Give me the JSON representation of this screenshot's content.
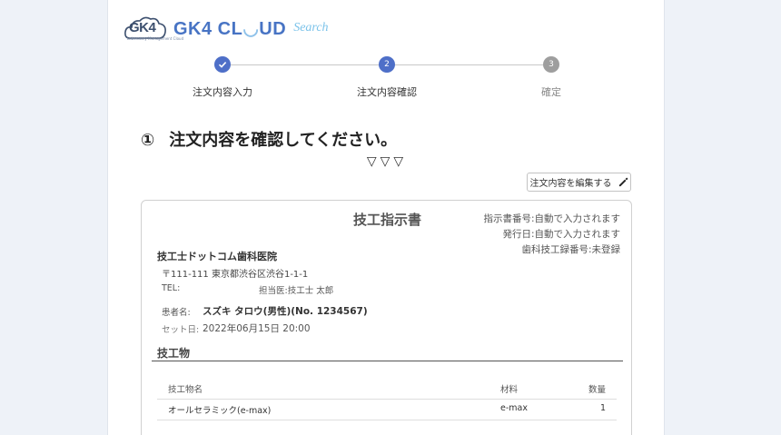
{
  "header": {
    "badge": "GK4",
    "badge_caption": "Laboratory Management Cloud",
    "logo_main_1": "GK4 CL",
    "logo_u": "◡",
    "logo_main_2": "UD",
    "logo_search": "Search",
    "brand_color": "#4874c4"
  },
  "stepper": {
    "steps": [
      {
        "number": "1",
        "label": "注文内容入力",
        "state": "done"
      },
      {
        "number": "2",
        "label": "注文内容確認",
        "state": "active"
      },
      {
        "number": "3",
        "label": "確定",
        "state": "pending"
      }
    ]
  },
  "heading": {
    "number": "①",
    "text": "注文内容を確認してください。"
  },
  "arrows": "▽▽▽",
  "edit_button": {
    "label": "注文内容を編集する",
    "icon": "pencil-icon"
  },
  "document": {
    "title": "技工指示書",
    "meta": [
      "指示書番号:自動で入力されます",
      "発行日:自動で入力されます",
      "歯科技工録番号:未登録"
    ],
    "clinic_name": "技工士ドットコム歯科医院",
    "address": "〒111-111 東京都渋谷区渋谷1-1-1",
    "tel_label": "TEL:",
    "doctor": "担当医:技工士 太郎",
    "patient_label": "患者名:",
    "patient": "スズキ タロウ(男性)(No. 1234567)",
    "set_label": "セット日:",
    "set_date": "2022年06月15日 20:00",
    "section_title": "技工物",
    "table": {
      "headers": [
        "技工物名",
        "材料",
        "数量"
      ],
      "rows": [
        [
          "オールセラミック(e-max)",
          "e-max",
          "1"
        ]
      ]
    }
  }
}
